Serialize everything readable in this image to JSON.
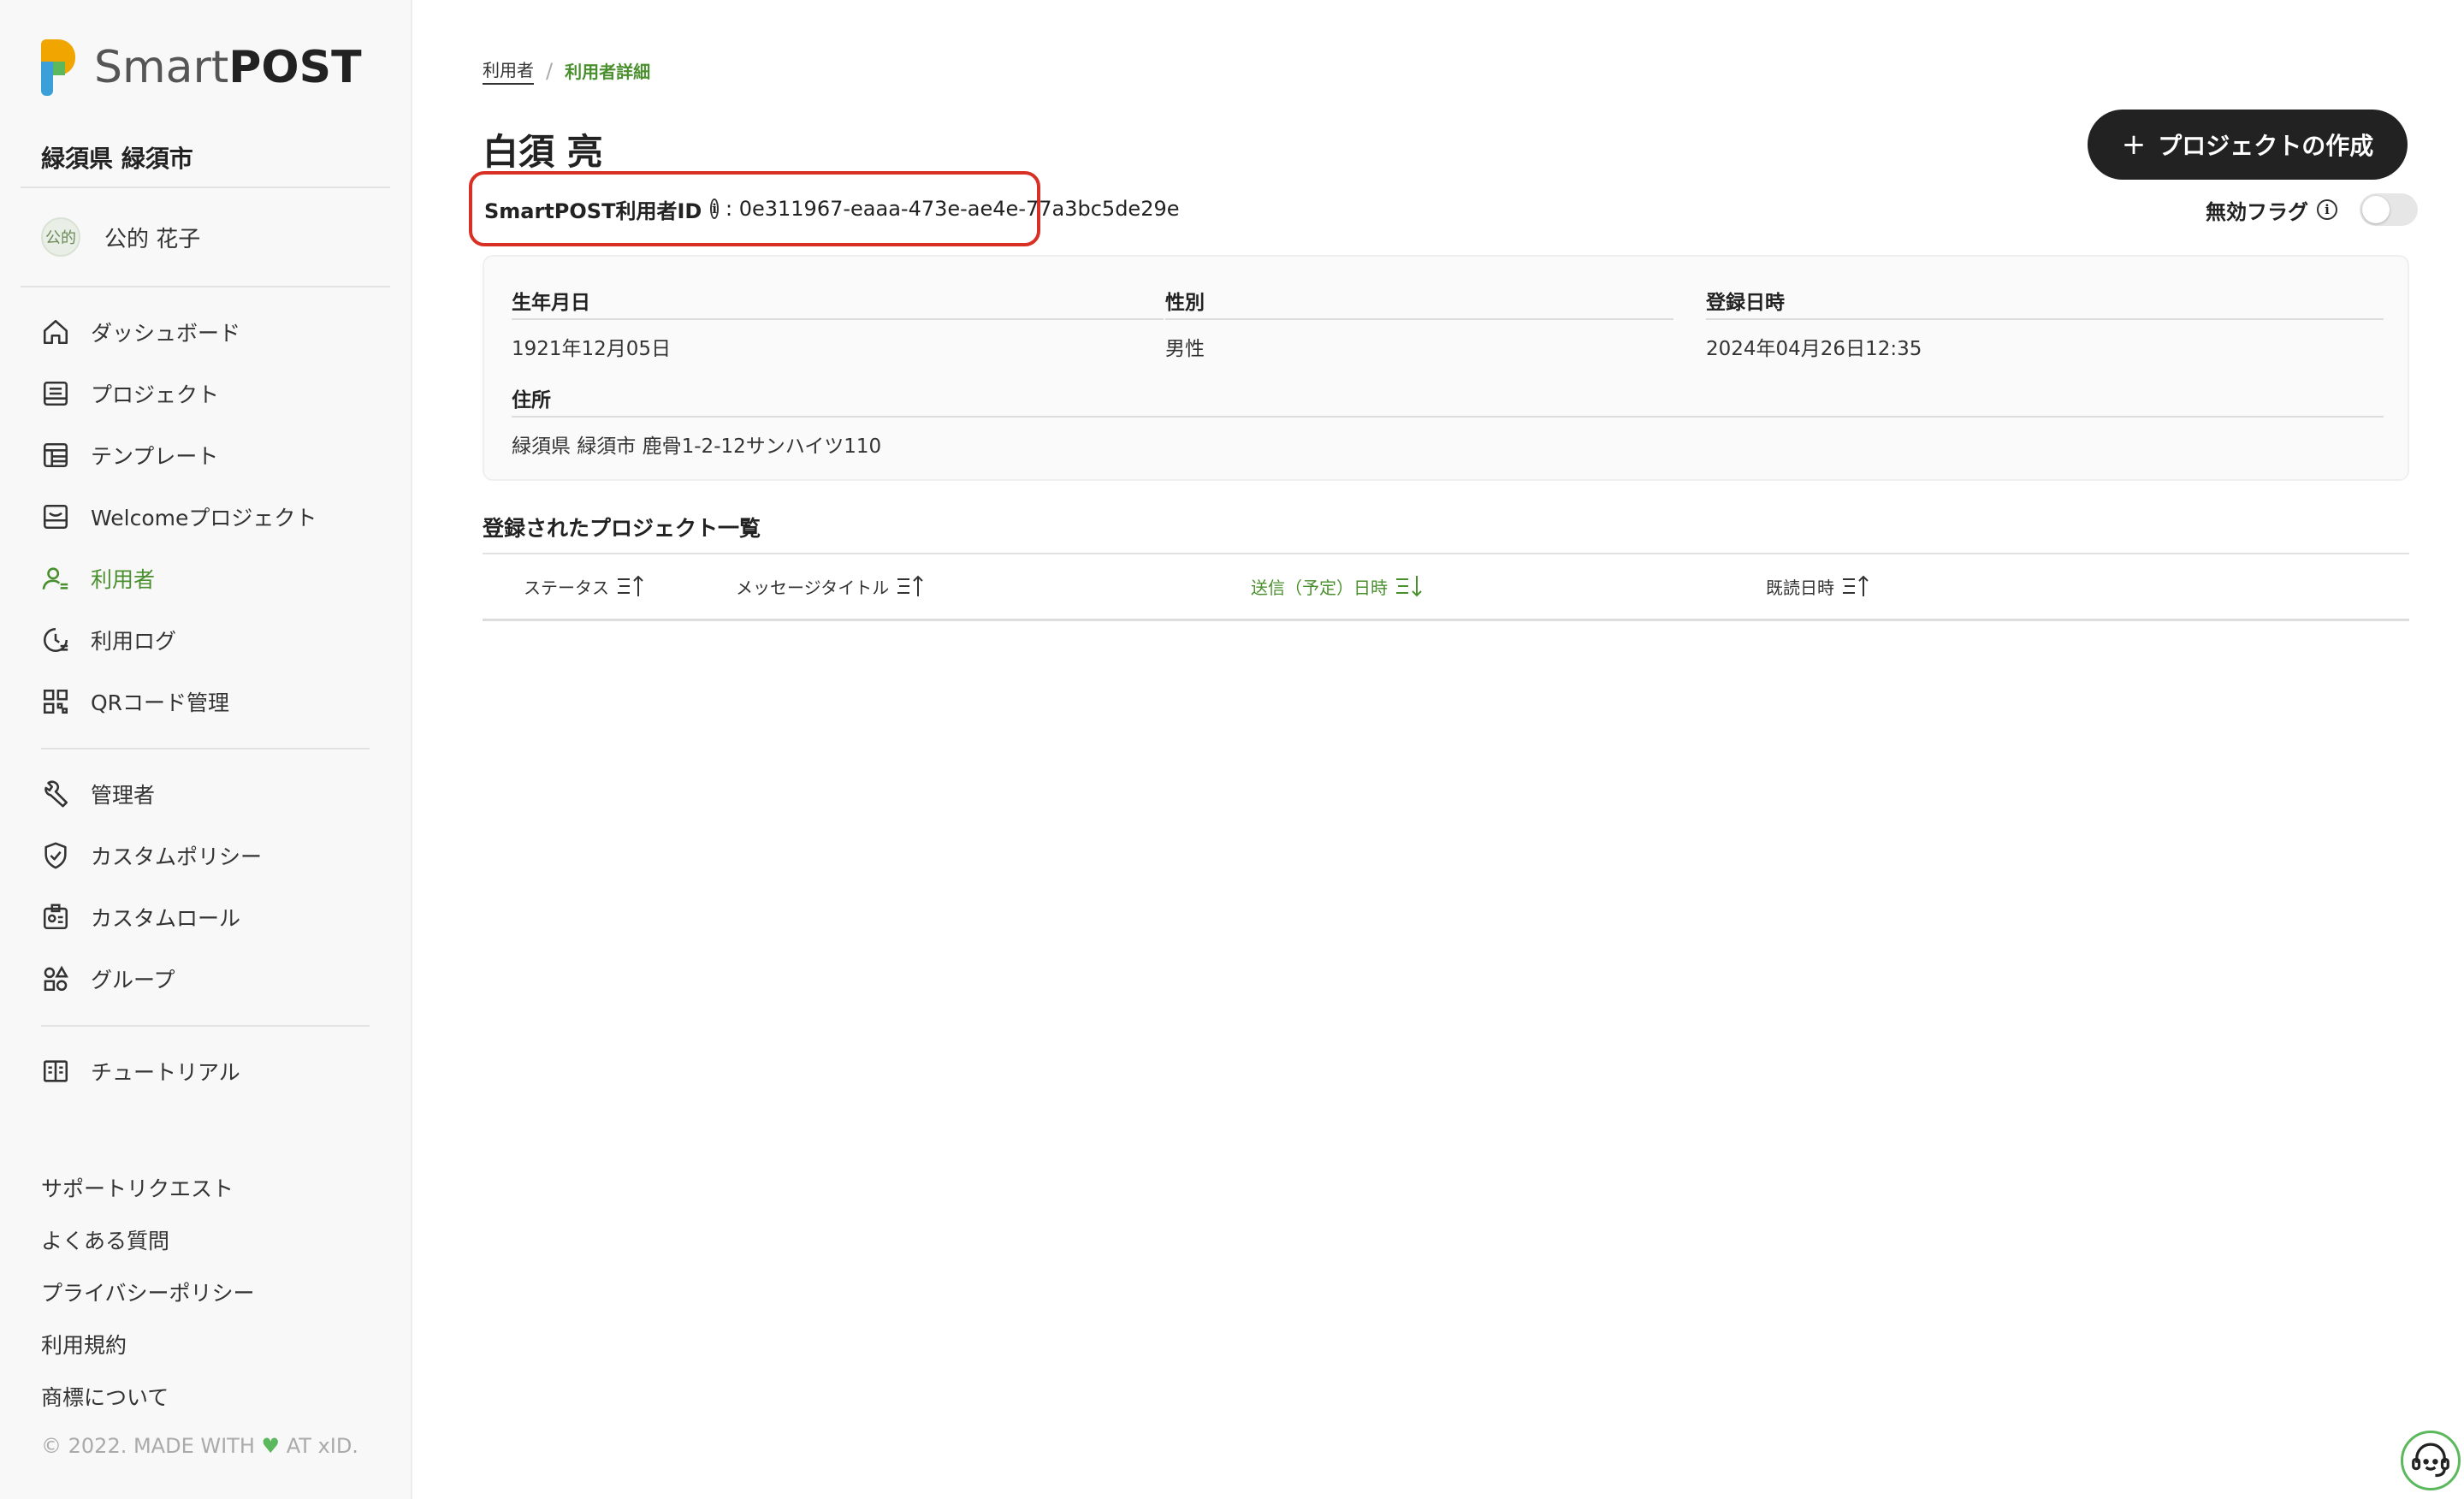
{
  "brand": {
    "logo_light": "Smart",
    "logo_bold": "POST"
  },
  "sidebar": {
    "org": "緑須県 緑須市",
    "user": {
      "avatar": "公的",
      "name": "公的 花子"
    },
    "nav": [
      {
        "label": "ダッシュボード",
        "icon": "home-icon"
      },
      {
        "label": "プロジェクト",
        "icon": "project-icon"
      },
      {
        "label": "テンプレート",
        "icon": "template-icon"
      },
      {
        "label": "Welcomeプロジェクト",
        "icon": "welcome-icon"
      },
      {
        "label": "利用者",
        "icon": "user-icon",
        "active": true
      },
      {
        "label": "利用ログ",
        "icon": "log-icon"
      },
      {
        "label": "QRコード管理",
        "icon": "qr-icon"
      }
    ],
    "admin_nav": [
      {
        "label": "管理者",
        "icon": "wrench-icon"
      },
      {
        "label": "カスタムポリシー",
        "icon": "shield-icon"
      },
      {
        "label": "カスタムロール",
        "icon": "id-card-icon"
      },
      {
        "label": "グループ",
        "icon": "group-icon"
      }
    ],
    "extra_nav": [
      {
        "label": "チュートリアル",
        "icon": "book-icon"
      }
    ],
    "footer_links": [
      "サポートリクエスト",
      "よくある質問",
      "プライバシーポリシー",
      "利用規約",
      "商標について"
    ],
    "copyright_pre": "© 2022. MADE WITH",
    "copyright_post": "AT xID."
  },
  "breadcrumb": {
    "parent": "利用者",
    "current": "利用者詳細"
  },
  "user_detail": {
    "name": "白須 亮",
    "id_label": "SmartPOST利用者ID",
    "id_value": ": 0e311967-eaaa-473e-ae4e-77a3bc5de29e",
    "flag_label": "無効フラグ",
    "flag_on": false,
    "create_button": "プロジェクトの作成",
    "fields": {
      "birthdate": {
        "label": "生年月日",
        "value": "1921年12月05日"
      },
      "gender": {
        "label": "性別",
        "value": "男性"
      },
      "registered": {
        "label": "登録日時",
        "value": "2024年04月26日12:35"
      },
      "address": {
        "label": "住所",
        "value": "緑須県 緑須市 鹿骨1-2-12サンハイツ110"
      }
    }
  },
  "projects": {
    "title": "登録されたプロジェクト一覧",
    "columns": [
      {
        "label": "ステータス",
        "sort": "asc",
        "active": false
      },
      {
        "label": "メッセージタイトル",
        "sort": "asc",
        "active": false
      },
      {
        "label": "送信（予定）日時",
        "sort": "desc",
        "active": true
      },
      {
        "label": "既読日時",
        "sort": "asc",
        "active": false
      }
    ],
    "rows": []
  },
  "colors": {
    "accent": "#4a8f2e",
    "highlight": "#d93025",
    "button": "#222222"
  }
}
